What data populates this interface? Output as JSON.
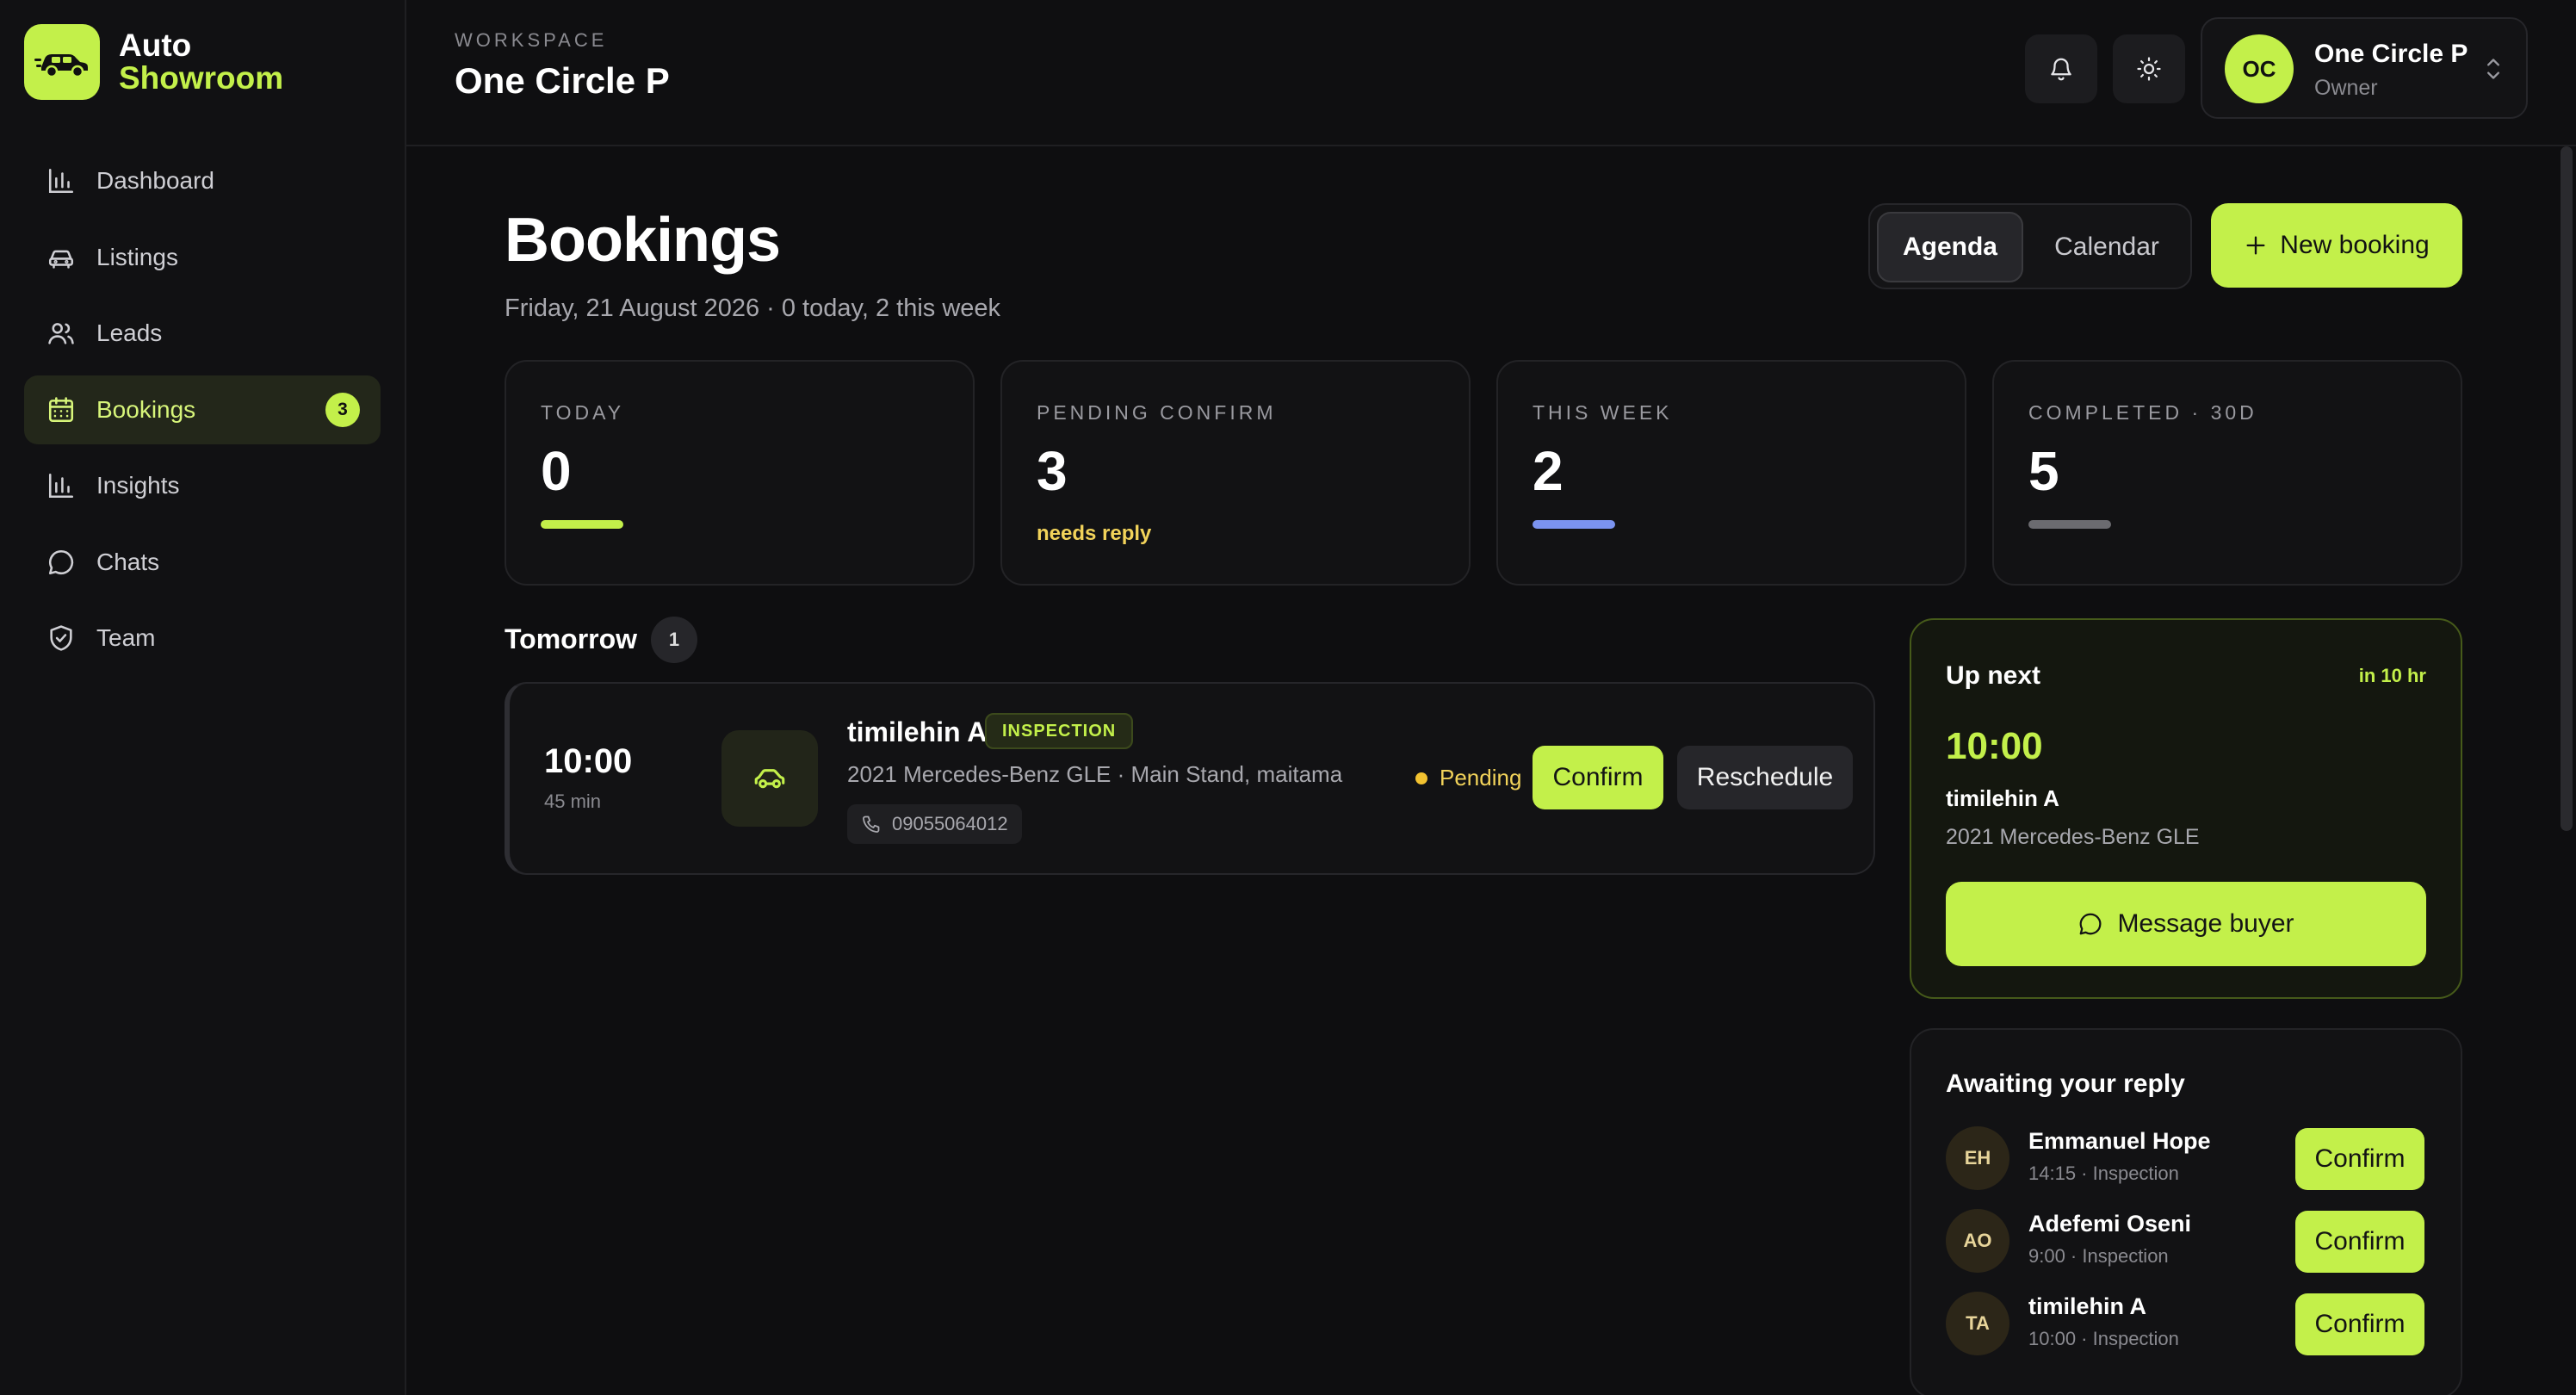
{
  "brand": {
    "line1": "Auto",
    "line2": "Showroom",
    "accent": "#c3f04a"
  },
  "sidebar": {
    "items": [
      {
        "label": "Dashboard",
        "icon": "bar-chart-icon"
      },
      {
        "label": "Listings",
        "icon": "car-icon"
      },
      {
        "label": "Leads",
        "icon": "users-icon"
      },
      {
        "label": "Bookings",
        "icon": "calendar-icon",
        "badge": "3",
        "active": true
      },
      {
        "label": "Insights",
        "icon": "bar-chart-icon"
      },
      {
        "label": "Chats",
        "icon": "chat-bubble-icon"
      },
      {
        "label": "Team",
        "icon": "shield-icon"
      }
    ]
  },
  "header": {
    "workspace_label": "WORKSPACE",
    "workspace_name": "One Circle P",
    "user": {
      "initials": "OC",
      "name": "One Circle P",
      "role": "Owner"
    }
  },
  "page": {
    "title": "Bookings",
    "subtitle": "Friday, 21 August 2026 · 0 today, 2 this week",
    "view_toggle": {
      "agenda": "Agenda",
      "calendar": "Calendar",
      "selected": "Agenda"
    },
    "new_booking": "New booking"
  },
  "stats": [
    {
      "label": "TODAY",
      "value": "0",
      "bar_color": "#c3f04a"
    },
    {
      "label": "PENDING CONFIRM",
      "value": "3",
      "note": "needs reply"
    },
    {
      "label": "THIS WEEK",
      "value": "2",
      "bar_color": "#7b93f0"
    },
    {
      "label": "COMPLETED · 30D",
      "value": "5",
      "bar_color": "#6b6b70"
    }
  ],
  "tomorrow": {
    "title": "Tomorrow",
    "count": "1",
    "booking": {
      "time": "10:00",
      "duration": "45 min",
      "name": "timilehin A",
      "tag": "INSPECTION",
      "description": "2021 Mercedes-Benz GLE · Main Stand, maitama",
      "phone": "09055064012",
      "status": "Pending",
      "confirm": "Confirm",
      "reschedule": "Reschedule"
    }
  },
  "up_next": {
    "title": "Up next",
    "eta": "in 10 hr",
    "time": "10:00",
    "name": "timilehin A",
    "car": "2021 Mercedes-Benz GLE",
    "message_button": "Message buyer"
  },
  "awaiting": {
    "title": "Awaiting your reply",
    "rows": [
      {
        "initials": "EH",
        "name": "Emmanuel Hope",
        "meta": "14:15 · Inspection",
        "action": "Confirm"
      },
      {
        "initials": "AO",
        "name": "Adefemi Oseni",
        "meta": "9:00 · Inspection",
        "action": "Confirm"
      },
      {
        "initials": "TA",
        "name": "timilehin A",
        "meta": "10:00 · Inspection",
        "action": "Confirm"
      }
    ]
  }
}
